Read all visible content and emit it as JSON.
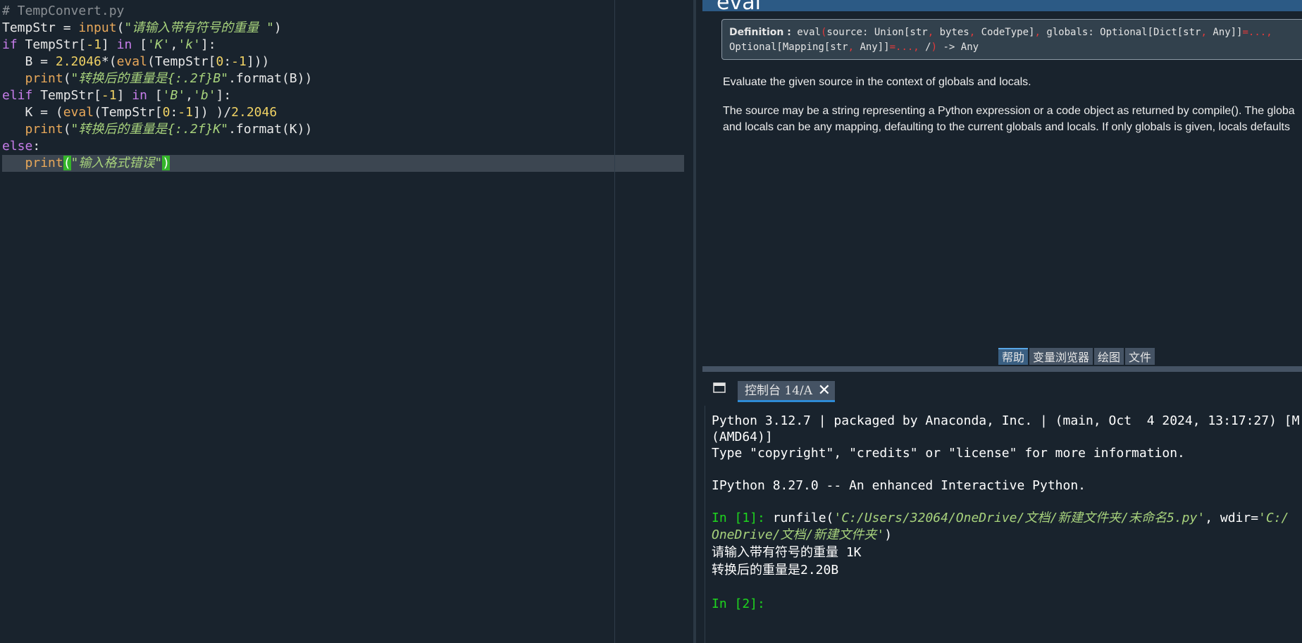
{
  "editor": {
    "lines": [
      {
        "tokens": [
          {
            "t": "# TempConvert.py",
            "c": "c-com"
          }
        ]
      },
      {
        "tokens": [
          {
            "t": "TempStr = ",
            "c": "c-var"
          },
          {
            "t": "input",
            "c": "c-fn"
          },
          {
            "t": "(",
            "c": "c-var"
          },
          {
            "t": "\"请输入带有符号的重量 \"",
            "c": "c-str"
          },
          {
            "t": ")",
            "c": "c-var"
          }
        ]
      },
      {
        "tokens": [
          {
            "t": "if",
            "c": "c-kw"
          },
          {
            "t": " TempStr[",
            "c": "c-var"
          },
          {
            "t": "-1",
            "c": "c-num"
          },
          {
            "t": "] ",
            "c": "c-var"
          },
          {
            "t": "in",
            "c": "c-kw"
          },
          {
            "t": " [",
            "c": "c-var"
          },
          {
            "t": "'K'",
            "c": "c-str"
          },
          {
            "t": ",",
            "c": "c-var"
          },
          {
            "t": "'k'",
            "c": "c-str"
          },
          {
            "t": "]:",
            "c": "c-var"
          }
        ]
      },
      {
        "tokens": [
          {
            "t": "   B = ",
            "c": "c-var"
          },
          {
            "t": "2.2046",
            "c": "c-num"
          },
          {
            "t": "*(",
            "c": "c-var"
          },
          {
            "t": "eval",
            "c": "c-fn"
          },
          {
            "t": "(TempStr[",
            "c": "c-var"
          },
          {
            "t": "0",
            "c": "c-num"
          },
          {
            "t": ":",
            "c": "c-var"
          },
          {
            "t": "-1",
            "c": "c-num"
          },
          {
            "t": "]))",
            "c": "c-var"
          }
        ]
      },
      {
        "tokens": [
          {
            "t": "   ",
            "c": "c-var"
          },
          {
            "t": "print",
            "c": "c-fn"
          },
          {
            "t": "(",
            "c": "c-var"
          },
          {
            "t": "\"转换后的重量是{:.2f}B\"",
            "c": "c-str"
          },
          {
            "t": ".format(B))",
            "c": "c-var"
          }
        ]
      },
      {
        "tokens": [
          {
            "t": "elif",
            "c": "c-kw"
          },
          {
            "t": " TempStr[",
            "c": "c-var"
          },
          {
            "t": "-1",
            "c": "c-num"
          },
          {
            "t": "] ",
            "c": "c-var"
          },
          {
            "t": "in",
            "c": "c-kw"
          },
          {
            "t": " [",
            "c": "c-var"
          },
          {
            "t": "'B'",
            "c": "c-str"
          },
          {
            "t": ",",
            "c": "c-var"
          },
          {
            "t": "'b'",
            "c": "c-str"
          },
          {
            "t": "]:",
            "c": "c-var"
          }
        ]
      },
      {
        "tokens": [
          {
            "t": "   K = (",
            "c": "c-var"
          },
          {
            "t": "eval",
            "c": "c-fn"
          },
          {
            "t": "(TempStr[",
            "c": "c-var"
          },
          {
            "t": "0",
            "c": "c-num"
          },
          {
            "t": ":",
            "c": "c-var"
          },
          {
            "t": "-1",
            "c": "c-num"
          },
          {
            "t": "]) )/",
            "c": "c-var"
          },
          {
            "t": "2.2046",
            "c": "c-num"
          }
        ]
      },
      {
        "tokens": [
          {
            "t": "   ",
            "c": "c-var"
          },
          {
            "t": "print",
            "c": "c-fn"
          },
          {
            "t": "(",
            "c": "c-var"
          },
          {
            "t": "\"转换后的重量是{:.2f}K\"",
            "c": "c-str"
          },
          {
            "t": ".format(K))",
            "c": "c-var"
          }
        ]
      },
      {
        "tokens": [
          {
            "t": "else",
            "c": "c-kw"
          },
          {
            "t": ":",
            "c": "c-var"
          }
        ]
      },
      {
        "tokens": [
          {
            "t": "   ",
            "c": "c-var"
          },
          {
            "t": "print",
            "c": "c-fn"
          },
          {
            "t": "(",
            "c": "c-hl"
          },
          {
            "t": "\"输入格式错误\"",
            "c": "c-str"
          },
          {
            "t": ")",
            "c": "c-hl"
          }
        ],
        "current": true
      }
    ]
  },
  "help": {
    "title": "eval",
    "definition": {
      "label": "Definition :",
      "line1_a": " eval",
      "line1_b": "(",
      "line1_c": "source: Union[str",
      "line1_d": ",",
      "line1_e": " bytes",
      "line1_f": ",",
      "line1_g": " CodeType]",
      "line1_h": ",",
      "line1_i": " globals: Optional[Dict[str",
      "line1_j": ",",
      "line1_k": " Any]]",
      "line1_l": "=...,",
      "line2_a": "Optional[Mapping[str",
      "line2_b": ",",
      "line2_c": " Any]]",
      "line2_d": "=...,",
      "line2_e": " /",
      "line2_f": ")",
      "line2_g": " -> Any"
    },
    "para1": "Evaluate the given source in the context of globals and locals.",
    "para2_line1": "The source may be a string representing a Python expression or a code object as returned by compile(). The globa",
    "para2_line2": "and locals can be any mapping, defaulting to the current globals and locals. If only globals is given, locals defaults"
  },
  "pane_tabs": [
    "帮助",
    "变量浏览器",
    "绘图",
    "文件"
  ],
  "console": {
    "tab_label": "控制台 14/A",
    "lines": {
      "l1": "Python 3.12.7 | packaged by Anaconda, Inc. | (main, Oct  4 2024, 13:17:27) [M",
      "l2": "(AMD64)]",
      "l3": "Type \"copyright\", \"credits\" or \"license\" for more information.",
      "l4": "IPython 8.27.0 -- An enhanced Interactive Python.",
      "p1": "In [1]:",
      "cmd_a": " runfile(",
      "cmd_b": "'C:/Users/32064/OneDrive/文档/新建文件夹/未命名5.py'",
      "cmd_c": ", wdir=",
      "cmd_d": "'C:/",
      "cmd2_a": "OneDrive/文档/新建文件夹'",
      "cmd2_b": ")",
      "o1": "请输入带有符号的重量 1K",
      "o2": "转换后的重量是2.20B",
      "p2": "In [2]:"
    }
  }
}
